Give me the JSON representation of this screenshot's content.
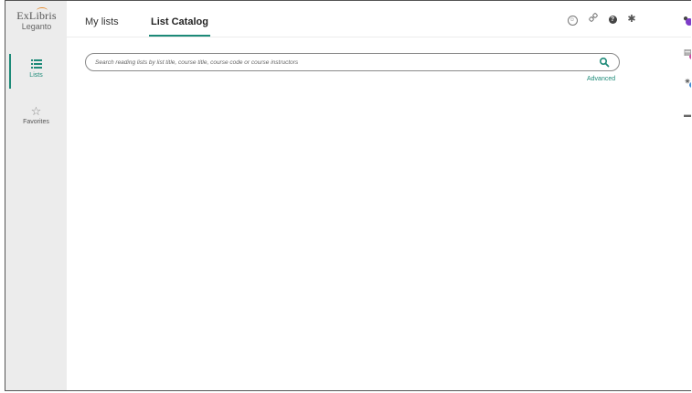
{
  "logo": {
    "brand": "ExLibris",
    "product": "Leganto"
  },
  "sidebar": {
    "items": [
      {
        "label": "Lists",
        "icon": "list-icon",
        "active": true
      },
      {
        "label": "Favorites",
        "icon": "star-outline-icon",
        "active": false
      }
    ]
  },
  "tabs": [
    {
      "label": "My lists",
      "selected": false
    },
    {
      "label": "List Catalog",
      "selected": true
    }
  ],
  "header_icons": [
    "accessibility-icon",
    "link-icon",
    "help-icon",
    "settings-icon",
    "notifications-icon"
  ],
  "right_panel_icons": [
    "comments-icon",
    "activity-icon",
    "archive-icon"
  ],
  "search": {
    "placeholder": "Search reading lists by list title, course title, course code or course instructors",
    "value": "",
    "advanced_label": "Advanced"
  },
  "colors": {
    "accent": "#1d8a78",
    "sidebar_bg": "#ececec",
    "notification_badge": "#7d3cc8"
  }
}
